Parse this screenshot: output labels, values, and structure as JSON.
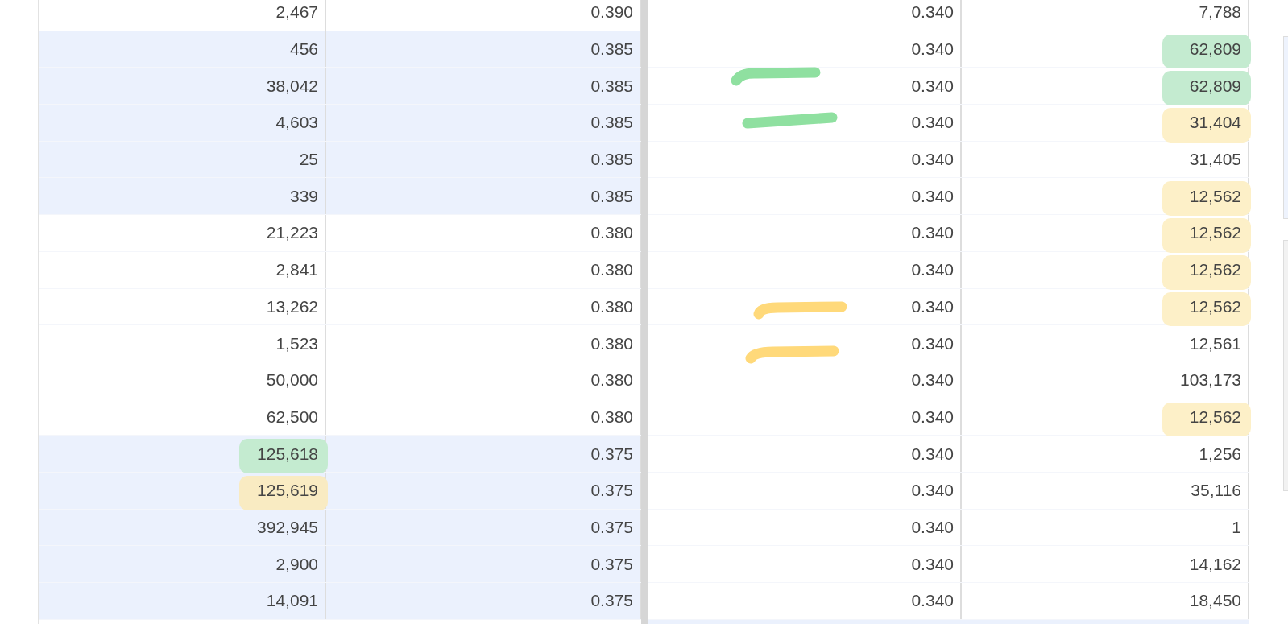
{
  "left_table": {
    "rows": [
      {
        "shaded": false,
        "cells": [
          {
            "text": "2,467"
          },
          {
            "text": "0.390"
          }
        ]
      },
      {
        "shaded": true,
        "cells": [
          {
            "text": "456"
          },
          {
            "text": "0.385"
          }
        ]
      },
      {
        "shaded": true,
        "cells": [
          {
            "text": "38,042"
          },
          {
            "text": "0.385"
          }
        ]
      },
      {
        "shaded": true,
        "cells": [
          {
            "text": "4,603"
          },
          {
            "text": "0.385"
          }
        ]
      },
      {
        "shaded": true,
        "cells": [
          {
            "text": "25"
          },
          {
            "text": "0.385"
          }
        ]
      },
      {
        "shaded": true,
        "cells": [
          {
            "text": "339"
          },
          {
            "text": "0.385"
          }
        ]
      },
      {
        "shaded": false,
        "cells": [
          {
            "text": "21,223"
          },
          {
            "text": "0.380"
          }
        ]
      },
      {
        "shaded": false,
        "cells": [
          {
            "text": "2,841"
          },
          {
            "text": "0.380"
          }
        ]
      },
      {
        "shaded": false,
        "cells": [
          {
            "text": "13,262"
          },
          {
            "text": "0.380"
          }
        ]
      },
      {
        "shaded": false,
        "cells": [
          {
            "text": "1,523"
          },
          {
            "text": "0.380"
          }
        ]
      },
      {
        "shaded": false,
        "cells": [
          {
            "text": "50,000"
          },
          {
            "text": "0.380"
          }
        ]
      },
      {
        "shaded": false,
        "cells": [
          {
            "text": "62,500"
          },
          {
            "text": "0.380"
          }
        ]
      },
      {
        "shaded": true,
        "cells": [
          {
            "text": "125,618",
            "color": "#c4ebd0"
          },
          {
            "text": "0.375"
          }
        ]
      },
      {
        "shaded": true,
        "cells": [
          {
            "text": "125,619",
            "color": "#f9ebc2"
          },
          {
            "text": "0.375"
          }
        ]
      },
      {
        "shaded": true,
        "cells": [
          {
            "text": "392,945"
          },
          {
            "text": "0.375"
          }
        ]
      },
      {
        "shaded": true,
        "cells": [
          {
            "text": "2,900"
          },
          {
            "text": "0.375"
          }
        ]
      },
      {
        "shaded": true,
        "cells": [
          {
            "text": "14,091"
          },
          {
            "text": "0.375"
          }
        ]
      }
    ]
  },
  "right_table": {
    "rows": [
      {
        "shaded": false,
        "cells": [
          {
            "text": "0.340"
          },
          {
            "text": "7,788"
          }
        ]
      },
      {
        "shaded": false,
        "cells": [
          {
            "text": "0.340"
          },
          {
            "text": "62,809",
            "color": "#c4ebd0"
          }
        ]
      },
      {
        "shaded": false,
        "cells": [
          {
            "text": "0.340"
          },
          {
            "text": "62,809",
            "color": "#c4ebd0"
          }
        ]
      },
      {
        "shaded": false,
        "cells": [
          {
            "text": "0.340"
          },
          {
            "text": "31,404",
            "color": "#fdf0c8"
          }
        ]
      },
      {
        "shaded": false,
        "cells": [
          {
            "text": "0.340"
          },
          {
            "text": "31,405"
          }
        ]
      },
      {
        "shaded": false,
        "cells": [
          {
            "text": "0.340"
          },
          {
            "text": "12,562",
            "color": "#fdf0c8"
          }
        ]
      },
      {
        "shaded": false,
        "cells": [
          {
            "text": "0.340"
          },
          {
            "text": "12,562",
            "color": "#fdf0c8"
          }
        ]
      },
      {
        "shaded": false,
        "cells": [
          {
            "text": "0.340"
          },
          {
            "text": "12,562",
            "color": "#fdf0c8"
          }
        ]
      },
      {
        "shaded": false,
        "cells": [
          {
            "text": "0.340"
          },
          {
            "text": "12,562",
            "color": "#fdf0c8"
          }
        ]
      },
      {
        "shaded": false,
        "cells": [
          {
            "text": "0.340"
          },
          {
            "text": "12,561"
          }
        ]
      },
      {
        "shaded": false,
        "cells": [
          {
            "text": "0.340"
          },
          {
            "text": "103,173"
          }
        ]
      },
      {
        "shaded": false,
        "cells": [
          {
            "text": "0.340"
          },
          {
            "text": "12,562",
            "color": "#fdf0c8"
          }
        ]
      },
      {
        "shaded": false,
        "cells": [
          {
            "text": "0.340"
          },
          {
            "text": "1,256"
          }
        ]
      },
      {
        "shaded": false,
        "cells": [
          {
            "text": "0.340"
          },
          {
            "text": "35,116"
          }
        ]
      },
      {
        "shaded": false,
        "cells": [
          {
            "text": "0.340"
          },
          {
            "text": "1"
          }
        ]
      },
      {
        "shaded": false,
        "cells": [
          {
            "text": "0.340"
          },
          {
            "text": "14,162"
          }
        ]
      },
      {
        "shaded": false,
        "cells": [
          {
            "text": "0.340"
          },
          {
            "text": "18,450"
          }
        ]
      }
    ]
  }
}
